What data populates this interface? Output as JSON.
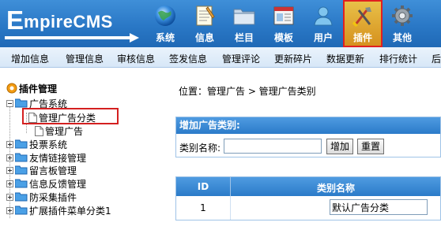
{
  "logo": {
    "first": "E",
    "rest": "mpireCMS"
  },
  "nav": [
    {
      "label": "系统",
      "icon": "globe-icon"
    },
    {
      "label": "信息",
      "icon": "notepad-icon"
    },
    {
      "label": "栏目",
      "icon": "folder-icon"
    },
    {
      "label": "模板",
      "icon": "window-icon"
    },
    {
      "label": "用户",
      "icon": "user-icon"
    },
    {
      "label": "插件",
      "icon": "tools-icon",
      "active": true
    },
    {
      "label": "其他",
      "icon": "gear-icon"
    }
  ],
  "menubar": [
    "增加信息",
    "管理信息",
    "审核信息",
    "签发信息",
    "管理评论",
    "更新碎片",
    "数据更新",
    "排行统计",
    "后"
  ],
  "tree": {
    "title": "插件管理",
    "items": [
      {
        "label": "广告系统",
        "expanded": true
      },
      {
        "label": "管理广告分类",
        "child": true,
        "highlighted": true
      },
      {
        "label": "管理广告",
        "child": true
      },
      {
        "label": "投票系统"
      },
      {
        "label": "友情链接管理"
      },
      {
        "label": "留言板管理"
      },
      {
        "label": "信息反馈管理"
      },
      {
        "label": "防采集插件"
      },
      {
        "label": "扩展插件菜单分类1"
      }
    ]
  },
  "breadcrumb": "位置：管理广告 > 管理广告类别",
  "form": {
    "title": "增加广告类别:",
    "field_label": "类别名称:",
    "field_value": "",
    "add_label": "增加",
    "reset_label": "重置"
  },
  "table": {
    "headers": {
      "id": "ID",
      "name": "类别名称"
    },
    "rows": [
      {
        "id": "1",
        "name": "默认广告分类"
      }
    ]
  },
  "colors": {
    "header_blue": "#2a78c6",
    "active_tab": "#e0a530",
    "highlight_red": "#d42020"
  }
}
